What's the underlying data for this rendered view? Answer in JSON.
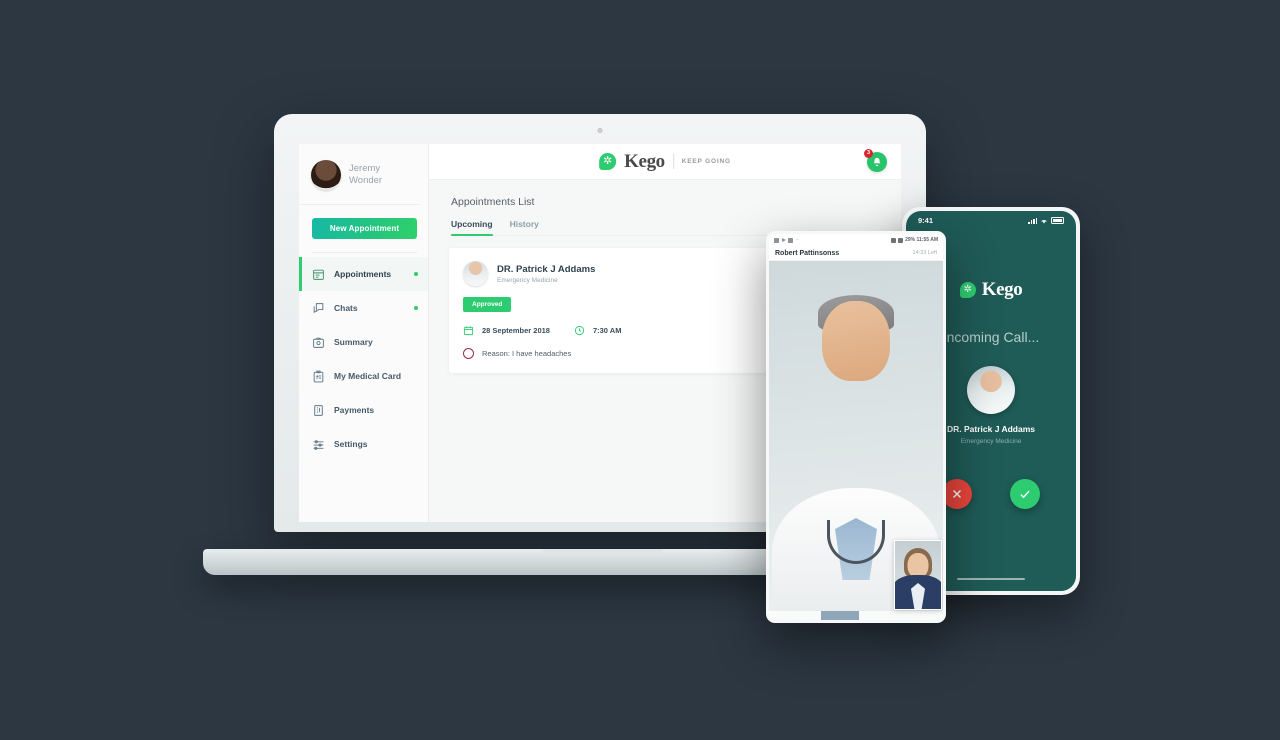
{
  "brand": {
    "name": "Kego",
    "tagline": "KEEP GOING",
    "mark_glyph": "✲"
  },
  "sidebar": {
    "profile": {
      "first_name": "Jeremy",
      "last_name": "Wonder"
    },
    "new_appointment_label": "New Appointment",
    "items": [
      {
        "label": "Appointments",
        "icon": "appointments-icon",
        "active": true,
        "dot": true
      },
      {
        "label": "Chats",
        "icon": "chats-icon",
        "active": false,
        "dot": true
      },
      {
        "label": "Summary",
        "icon": "summary-icon",
        "active": false,
        "dot": false
      },
      {
        "label": "My Medical Card",
        "icon": "medical-card-icon",
        "active": false,
        "dot": false
      },
      {
        "label": "Payments",
        "icon": "payments-icon",
        "active": false,
        "dot": false
      },
      {
        "label": "Settings",
        "icon": "settings-icon",
        "active": false,
        "dot": false
      }
    ]
  },
  "header": {
    "notification_icon": "bell-icon",
    "notification_count": "3"
  },
  "main": {
    "page_title": "Appointments List",
    "tabs": [
      {
        "label": "Upcoming",
        "active": true
      },
      {
        "label": "History",
        "active": false
      }
    ],
    "appointment": {
      "doctor_name": "DR. Patrick J Addams",
      "specialty": "Emergency Medicine",
      "status": "Approved",
      "date": "28 September 2018",
      "time": "7:30 AM",
      "reason": "Reason: I have headaches",
      "date_icon": "calendar-icon",
      "time_icon": "clock-icon",
      "reason_icon": "circle-icon"
    }
  },
  "phone_videocall": {
    "status_right": "29% 11:55 AM",
    "battery_percent": "29%",
    "clock": "11:55 AM",
    "contact_name": "Robert Pattinsonss",
    "call_duration": "14:33 Left"
  },
  "phone_incoming": {
    "clock": "9:41",
    "incoming_label": "Incoming Call...",
    "caller_name": "DR. Patrick J Addams",
    "caller_specialty": "Emergency Medicine",
    "decline_label": "✕",
    "accept_label": "✓"
  },
  "colors": {
    "background": "#2c3742",
    "brand_green": "#2ecc71",
    "accent_teal": "#18b8a5",
    "phone_teal": "#1f5b57",
    "decline_red": "#e8453c",
    "badge_red": "#d8262f",
    "text_dark": "#2f4250"
  }
}
